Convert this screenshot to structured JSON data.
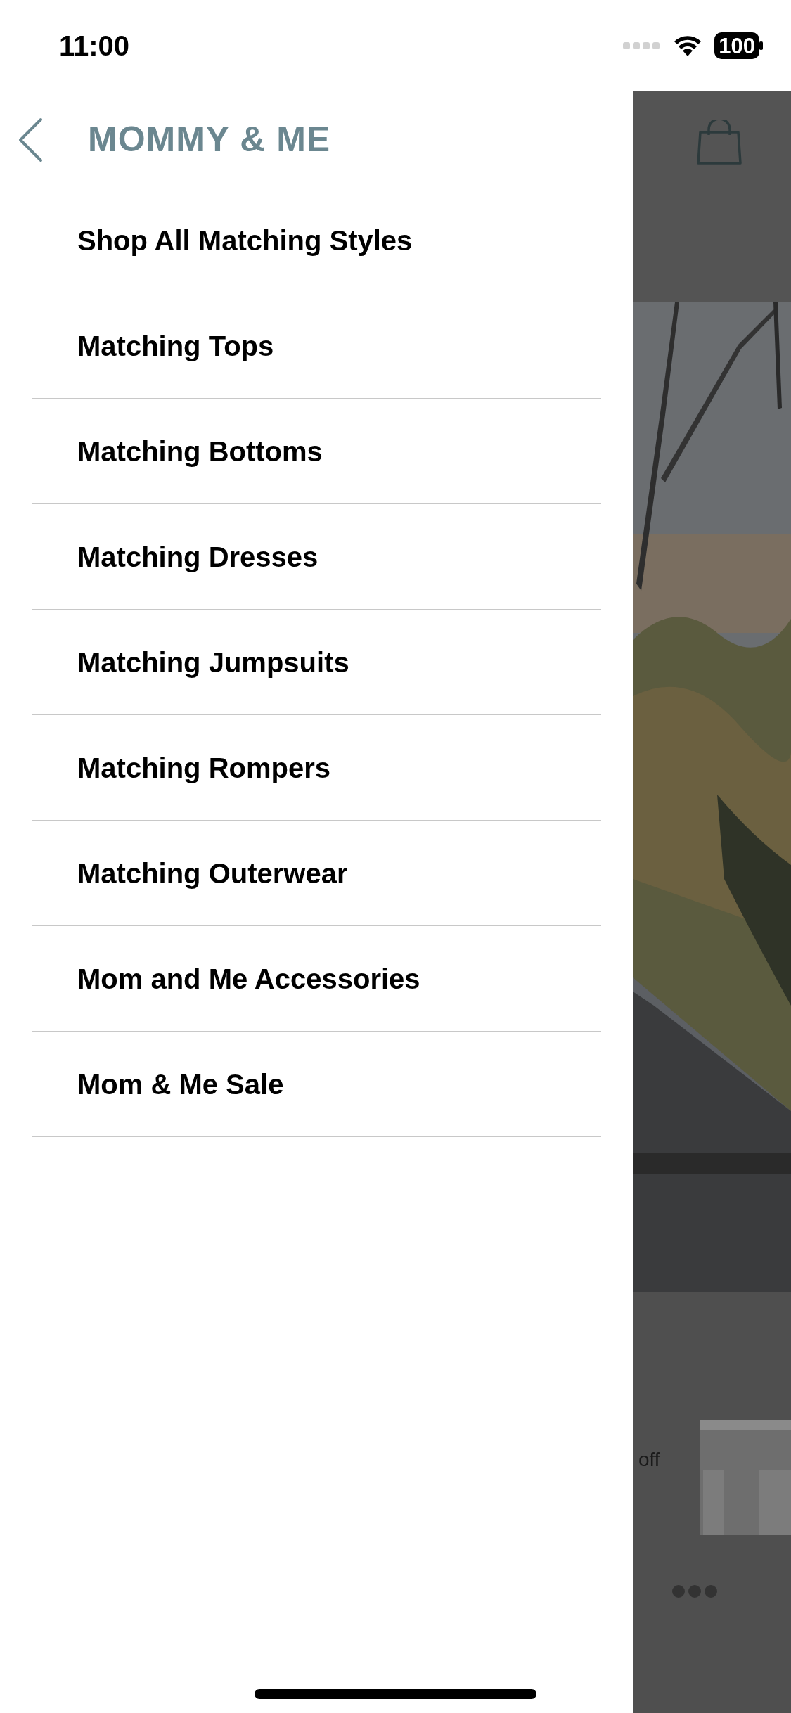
{
  "status_bar": {
    "time": "11:00",
    "battery": "100"
  },
  "drawer": {
    "title": "MOMMY & ME",
    "items": [
      {
        "label": "Shop All Matching Styles"
      },
      {
        "label": "Matching Tops"
      },
      {
        "label": "Matching Bottoms"
      },
      {
        "label": "Matching Dresses"
      },
      {
        "label": "Matching Jumpsuits"
      },
      {
        "label": "Matching Rompers"
      },
      {
        "label": "Matching Outerwear"
      },
      {
        "label": "Mom and Me Accessories"
      },
      {
        "label": "Mom & Me Sale"
      }
    ]
  },
  "background_page": {
    "promo_text": "off"
  }
}
